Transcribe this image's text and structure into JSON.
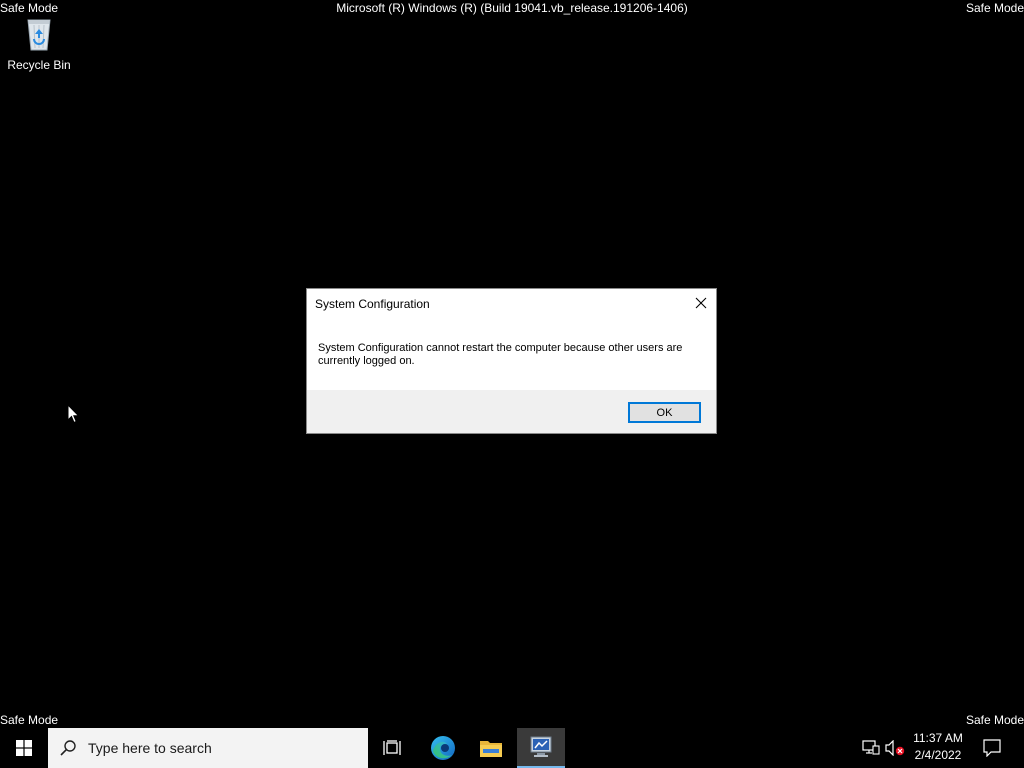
{
  "corner_labels": {
    "top_left": "Safe Mode",
    "top_right": "Safe Mode",
    "bottom_left": "Safe Mode",
    "bottom_right": "Safe Mode"
  },
  "build_label": "Microsoft (R) Windows (R) (Build 19041.vb_release.191206-1406)",
  "desktop": {
    "icons": [
      {
        "label": "Recycle Bin",
        "icon": "recycle-bin-icon"
      }
    ]
  },
  "dialog": {
    "title": "System Configuration",
    "message": "System Configuration cannot restart the computer because other users are currently logged on.",
    "ok_label": "OK",
    "close_icon": "close-icon"
  },
  "taskbar": {
    "start_icon": "windows-start-icon",
    "search_placeholder": "Type here to search",
    "search_icon": "search-icon",
    "apps": [
      {
        "name": "task-view",
        "icon": "task-view-icon"
      },
      {
        "name": "edge",
        "icon": "edge-icon"
      },
      {
        "name": "file-explorer",
        "icon": "folder-icon"
      },
      {
        "name": "system-configuration",
        "icon": "msconfig-icon",
        "active": true
      }
    ],
    "tray": {
      "network_icon": "network-icon",
      "volume_icon": "volume-muted-icon",
      "time": "11:37 AM",
      "date": "2/4/2022",
      "notification_icon": "notification-icon"
    }
  },
  "colors": {
    "desktop_bg": "#000000",
    "accent": "#0078d7",
    "taskbar_bg": "#000000",
    "search_bg": "#f3f3f3",
    "dialog_footer_bg": "#f0f0f0"
  }
}
